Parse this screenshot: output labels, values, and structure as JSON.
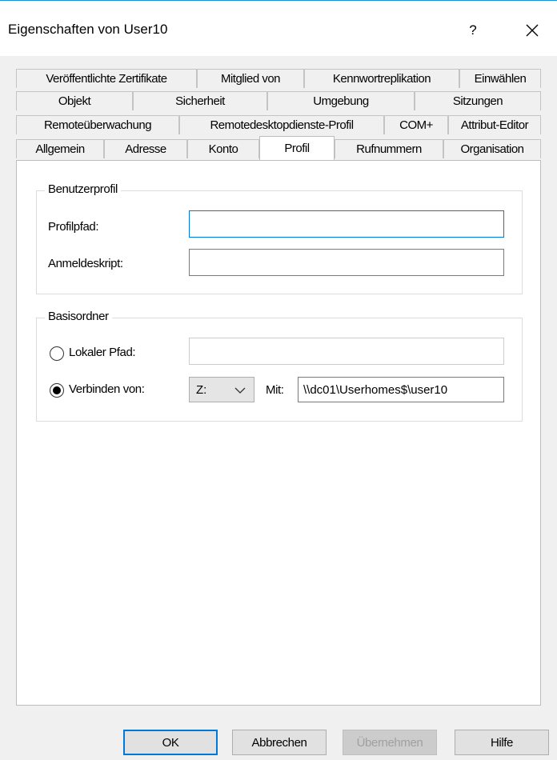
{
  "window": {
    "title": "Eigenschaften von User10",
    "help_label": "?",
    "close_icon": "close-icon"
  },
  "tabs": {
    "row1": [
      "Veröffentlichte Zertifikate",
      "Mitglied von",
      "Kennwortreplikation",
      "Einwählen"
    ],
    "row2": [
      "Objekt",
      "Sicherheit",
      "Umgebung",
      "Sitzungen"
    ],
    "row3": [
      "Remoteüberwachung",
      "Remotedesktopdienste-Profil",
      "COM+",
      "Attribut-Editor"
    ],
    "row4": [
      "Allgemein",
      "Adresse",
      "Konto",
      "Profil",
      "Rufnummern",
      "Organisation"
    ],
    "active": "Profil"
  },
  "benutzerprofil": {
    "legend": "Benutzerprofil",
    "profilpfad_label": "Profilpfad:",
    "profilpfad_value": "",
    "anmeldeskript_label": "Anmeldeskript:",
    "anmeldeskript_value": ""
  },
  "basisordner": {
    "legend": "Basisordner",
    "lokaler_pfad_label": "Lokaler Pfad:",
    "lokaler_pfad_value": "",
    "lokaler_pfad_selected": false,
    "verbinden_label": "Verbinden von:",
    "verbinden_selected": true,
    "drive_value": "Z:",
    "mit_label": "Mit:",
    "mit_value": "\\\\dc01\\Userhomes$\\user10"
  },
  "buttons": {
    "ok": "OK",
    "cancel": "Abbrechen",
    "apply": "Übernehmen",
    "help": "Hilfe"
  },
  "colors": {
    "accent": "#0078d7",
    "window_bg": "#f0f0f0",
    "panel_bg": "#ffffff"
  }
}
